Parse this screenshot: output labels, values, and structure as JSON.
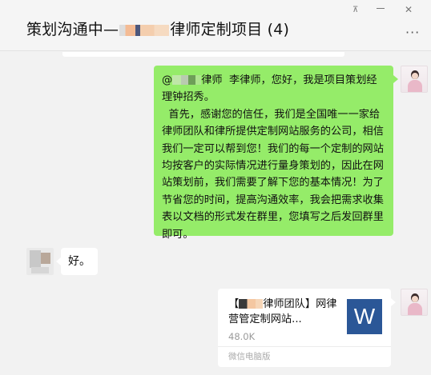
{
  "header": {
    "title_prefix": "策划沟通中—",
    "title_suffix": "律师定制项目 (4)",
    "pin_icon": "pin-icon",
    "minimize_icon": "minimize-icon",
    "close_icon": "close-icon",
    "more_icon": "more-icon",
    "more_glyph": "···",
    "close_glyph": "✕",
    "pin_glyph": "⊼"
  },
  "messages": {
    "outgoing_text": {
      "mention": "@",
      "mention_suffix": "律师  李律师，您好，我是项目策划经理钟招秀。\n  首先，感谢您的信任，我们是全国唯一一家给律师团队和律所提供定制网站服务的公司，相信我们一定可以帮到您！我们的每一个定制的网站均按客户的实际情况进行量身策划的，因此在网站策划前，我们需要了解下您的基本情况！为了节省您的时间，提高沟通效率，我会把需求收集表以文档的形式发在群里，您填写之后发回群里即可。"
    },
    "incoming_text": "好。",
    "file": {
      "name_prefix": "【",
      "name_suffix": "律师团队】网律营管定制网站...",
      "size": "48.0K",
      "source": "微信电脑版",
      "icon_letter": "W",
      "icon_color": "#2b5797"
    }
  },
  "colors": {
    "outgoing_bubble": "#95ec69",
    "incoming_bubble": "#ffffff",
    "background": "#f2f2f2"
  }
}
